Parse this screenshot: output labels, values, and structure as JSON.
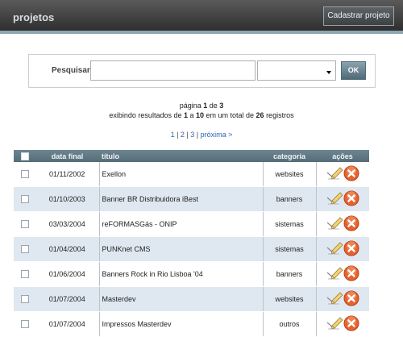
{
  "header": {
    "title": "projetos",
    "new_button": "Cadastrar projeto"
  },
  "search": {
    "label": "Pesquisar",
    "query": "",
    "category_selected": "",
    "submit": "OK"
  },
  "paging": {
    "prefix": "página ",
    "current": "1",
    "of": " de ",
    "total_pages": "3",
    "showing": "exibindo resultados de ",
    "from": "1",
    "to_word": " a ",
    "to": "10",
    "total_word": " em um total de ",
    "total": "26",
    "records": " registros",
    "pages": [
      "1",
      "2",
      "3"
    ],
    "sep": " | ",
    "next": "próxima >"
  },
  "table": {
    "columns": [
      "data final",
      "título",
      "categoria",
      "ações"
    ],
    "rows": [
      {
        "date": "01/11/2002",
        "title": "Exellon",
        "category": "websites"
      },
      {
        "date": "01/10/2003",
        "title": "Banner BR Distribuidora iBest",
        "category": "banners"
      },
      {
        "date": "03/03/2004",
        "title": "reFORMASGás - ONIP",
        "category": "sistemas"
      },
      {
        "date": "01/04/2004",
        "title": "PUNKnet CMS",
        "category": "sistemas"
      },
      {
        "date": "01/06/2004",
        "title": "Banners Rock in Rio Lisboa '04",
        "category": "banners"
      },
      {
        "date": "01/07/2004",
        "title": "Masterdev",
        "category": "websites"
      },
      {
        "date": "01/07/2004",
        "title": "Impressos Masterdev",
        "category": "outros"
      }
    ]
  },
  "colors": {
    "header": "#3a3a3a",
    "table_header": "#5f7884",
    "row_alt": "#dfe8f1",
    "link": "#2f5fb5",
    "delete": "#e8622c"
  },
  "icons": {
    "edit": "pencil-paper-icon",
    "delete": "delete-x-icon",
    "select": "chevron-down-icon"
  }
}
